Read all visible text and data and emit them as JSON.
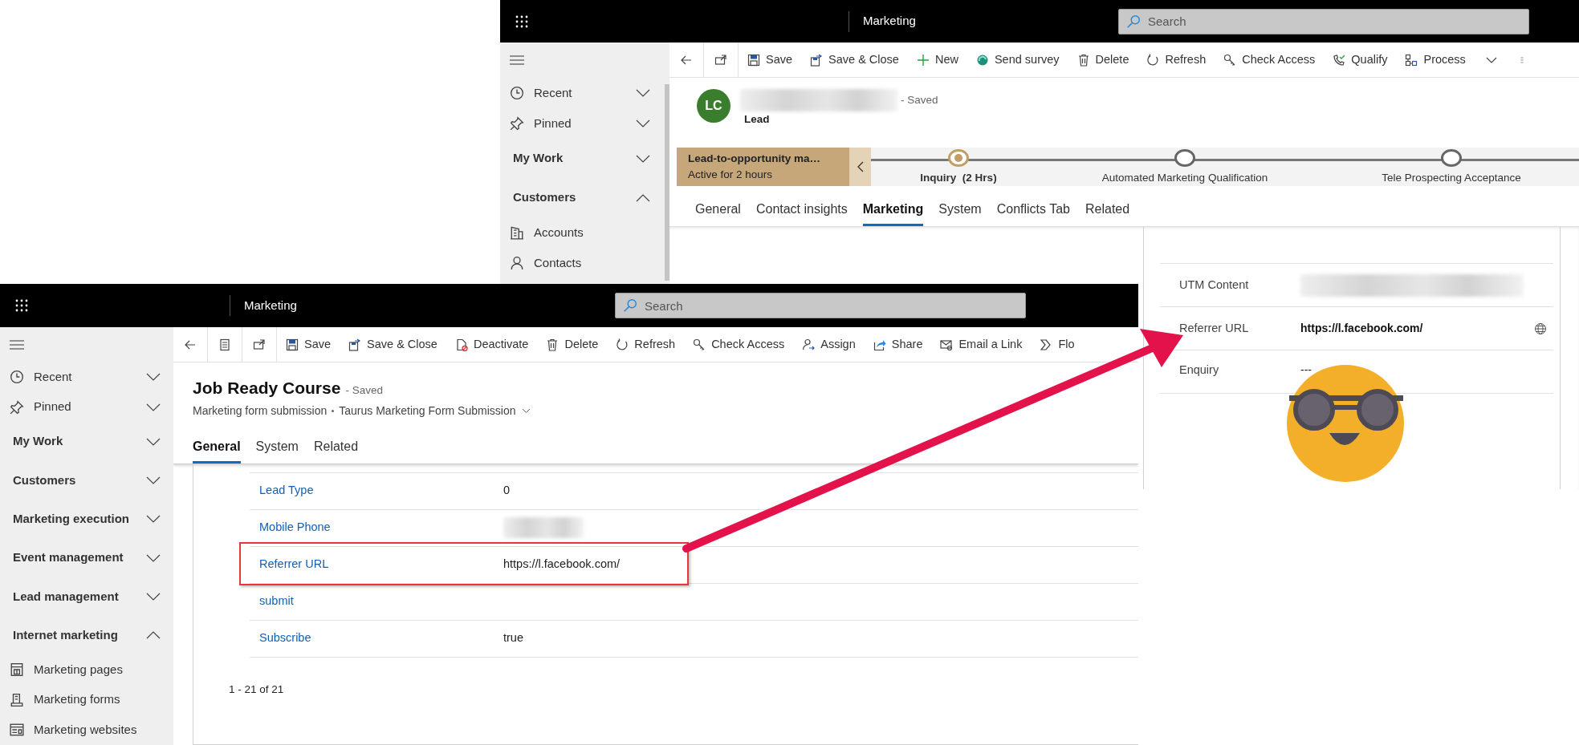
{
  "top_window": {
    "app_title": "Marketing",
    "search": {
      "placeholder": "Search"
    },
    "sidebar": [
      {
        "kind": "nav",
        "label": "Recent",
        "expanded": false
      },
      {
        "kind": "nav",
        "label": "Pinned",
        "expanded": false
      },
      {
        "kind": "group",
        "label": "My Work",
        "expanded": false
      },
      {
        "kind": "group",
        "label": "Customers",
        "expanded": true
      },
      {
        "kind": "entity",
        "label": "Accounts"
      },
      {
        "kind": "entity",
        "label": "Contacts"
      }
    ],
    "toolbar": [
      {
        "label": "Save"
      },
      {
        "label": "Save & Close"
      },
      {
        "label": "New"
      },
      {
        "label": "Send survey"
      },
      {
        "label": "Delete"
      },
      {
        "label": "Refresh"
      },
      {
        "label": "Check Access"
      },
      {
        "label": "Qualify"
      },
      {
        "label": "Process"
      }
    ],
    "record": {
      "initials": "LC",
      "status": "- Saved",
      "entity": "Lead"
    },
    "process": {
      "name": "Lead-to-opportunity ma…",
      "duration": "Active for 2 hours",
      "stages": [
        {
          "label": "Inquiry",
          "duration": "(2 Hrs)",
          "selected": true
        },
        {
          "label": "Automated Marketing Qualification",
          "selected": false
        },
        {
          "label": "Tele Prospecting Acceptance",
          "selected": false
        }
      ]
    },
    "tabs": [
      {
        "label": "General",
        "selected": false
      },
      {
        "label": "Contact insights",
        "selected": false
      },
      {
        "label": "Marketing",
        "selected": true
      },
      {
        "label": "System",
        "selected": false
      },
      {
        "label": "Conflicts Tab",
        "selected": false
      },
      {
        "label": "Related",
        "selected": false
      }
    ],
    "fields": [
      {
        "kind": "blurred",
        "label": "UTM Content"
      },
      {
        "kind": "url",
        "label": "Referrer URL",
        "value": "https://l.facebook.com/"
      },
      {
        "kind": "text",
        "label": "Enquiry",
        "value": "---"
      }
    ]
  },
  "bottom_window": {
    "app_title": "Marketing",
    "search": {
      "placeholder": "Search"
    },
    "sidebar": [
      {
        "kind": "nav",
        "label": "Recent",
        "expanded": false
      },
      {
        "kind": "nav",
        "label": "Pinned",
        "expanded": false
      },
      {
        "kind": "group",
        "label": "My Work",
        "expanded": false
      },
      {
        "kind": "group",
        "label": "Customers",
        "expanded": false
      },
      {
        "kind": "group",
        "label": "Marketing execution",
        "expanded": false
      },
      {
        "kind": "group",
        "label": "Event management",
        "expanded": false
      },
      {
        "kind": "group",
        "label": "Lead management",
        "expanded": false
      },
      {
        "kind": "group",
        "label": "Internet marketing",
        "expanded": true
      },
      {
        "kind": "entity",
        "label": "Marketing pages"
      },
      {
        "kind": "entity",
        "label": "Marketing forms"
      },
      {
        "kind": "entity",
        "label": "Marketing websites"
      }
    ],
    "toolbar": [
      {
        "label": "Save"
      },
      {
        "label": "Save & Close"
      },
      {
        "label": "Deactivate"
      },
      {
        "label": "Delete"
      },
      {
        "label": "Refresh"
      },
      {
        "label": "Check Access"
      },
      {
        "label": "Assign"
      },
      {
        "label": "Share"
      },
      {
        "label": "Email a Link"
      },
      {
        "label": "Flo"
      }
    ],
    "record": {
      "title": "Job Ready Course",
      "status": "- Saved",
      "entity": "Marketing form submission",
      "form": "Taurus Marketing Form Submission"
    },
    "tabs": [
      {
        "label": "General",
        "selected": true
      },
      {
        "label": "System",
        "selected": false
      },
      {
        "label": "Related",
        "selected": false
      }
    ],
    "fields": [
      {
        "kind": "text",
        "label": "Lead Type",
        "value": "0",
        "highlighted": false
      },
      {
        "kind": "blurred",
        "label": "Mobile Phone",
        "highlighted": false
      },
      {
        "kind": "text",
        "label": "Referrer URL",
        "value": "https://l.facebook.com/",
        "highlighted": true
      },
      {
        "kind": "text",
        "label": "submit",
        "highlighted": false
      },
      {
        "kind": "text",
        "label": "Subscribe",
        "value": "true",
        "highlighted": false
      }
    ],
    "pager": "1 - 21 of 21"
  }
}
